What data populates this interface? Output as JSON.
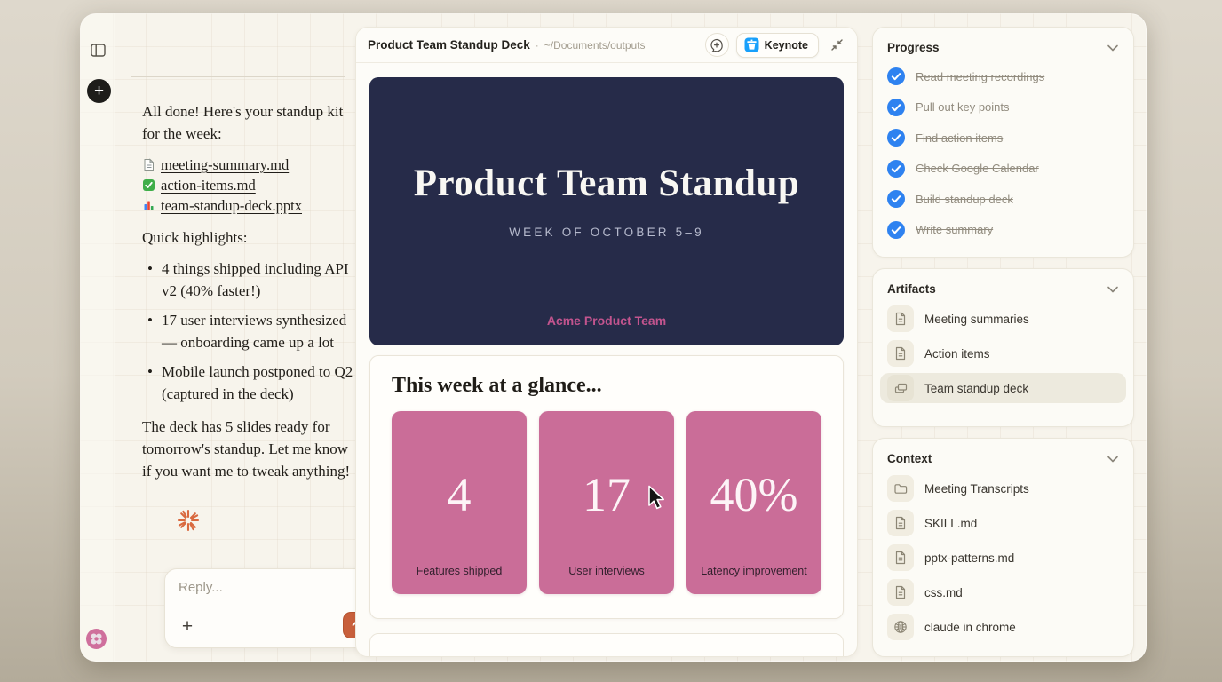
{
  "colors": {
    "accent_orange": "#c8603c",
    "starburst_orange": "#d9693f",
    "slide_navy": "#262b49",
    "stat_pink": "#ca6d98",
    "brand_pink": "#c2548e",
    "check_blue": "#2e82f0",
    "keynote_blue": "#18a0fb",
    "window_bg": "#f7f4ec"
  },
  "chat": {
    "message": {
      "intro": "All done! Here's your standup kit for the week:",
      "files": [
        {
          "icon": "page-icon",
          "label": "meeting-summary.md"
        },
        {
          "icon": "check-green-icon",
          "label": "action-items.md"
        },
        {
          "icon": "bar-chart-icon",
          "label": "team-standup-deck.pptx"
        }
      ],
      "highlights_title": "Quick highlights:",
      "highlights": [
        "4 things shipped including API v2 (40% faster!)",
        "17 user interviews synthesized — onboarding came up a lot",
        "Mobile launch postponed to Q2 (captured in the deck)"
      ],
      "closing": "The deck has 5 slides ready for tomorrow's standup. Let me know if you want me to tweak anything!"
    },
    "reply": {
      "placeholder": "Reply...",
      "plus_label": "+"
    },
    "new_chat_label": "+"
  },
  "document": {
    "title": "Product Team Standup Deck",
    "separator": "·",
    "path": "~/Documents/outputs",
    "keynote_label": "Keynote",
    "slide1": {
      "title": "Product Team Standup",
      "subtitle": "WEEK OF OCTOBER 5–9",
      "footer": "Acme Product Team"
    },
    "slide2": {
      "heading": "This week at a glance...",
      "stats": [
        {
          "value": "4",
          "label": "Features shipped"
        },
        {
          "value": "17",
          "label": "User interviews"
        },
        {
          "value": "40%",
          "label": "Latency improvement"
        }
      ]
    }
  },
  "sidebar": {
    "progress": {
      "title": "Progress",
      "items": [
        {
          "label": "Read meeting recordings",
          "done": true
        },
        {
          "label": "Pull out key points",
          "done": true
        },
        {
          "label": "Find action items",
          "done": true
        },
        {
          "label": "Check Google Calendar",
          "done": true
        },
        {
          "label": "Build standup deck",
          "done": true
        },
        {
          "label": "Write summary",
          "done": true
        }
      ]
    },
    "artifacts": {
      "title": "Artifacts",
      "items": [
        {
          "icon": "document-icon",
          "label": "Meeting summaries",
          "selected": false
        },
        {
          "icon": "document-icon",
          "label": "Action items",
          "selected": false
        },
        {
          "icon": "slides-icon",
          "label": "Team standup deck",
          "selected": true
        }
      ]
    },
    "context": {
      "title": "Context",
      "items": [
        {
          "icon": "folder-icon",
          "label": "Meeting Transcripts"
        },
        {
          "icon": "document-icon",
          "label": "SKILL.md"
        },
        {
          "icon": "document-icon",
          "label": "pptx-patterns.md"
        },
        {
          "icon": "document-icon",
          "label": "css.md"
        },
        {
          "icon": "globe-icon",
          "label": "claude in chrome"
        }
      ]
    }
  }
}
